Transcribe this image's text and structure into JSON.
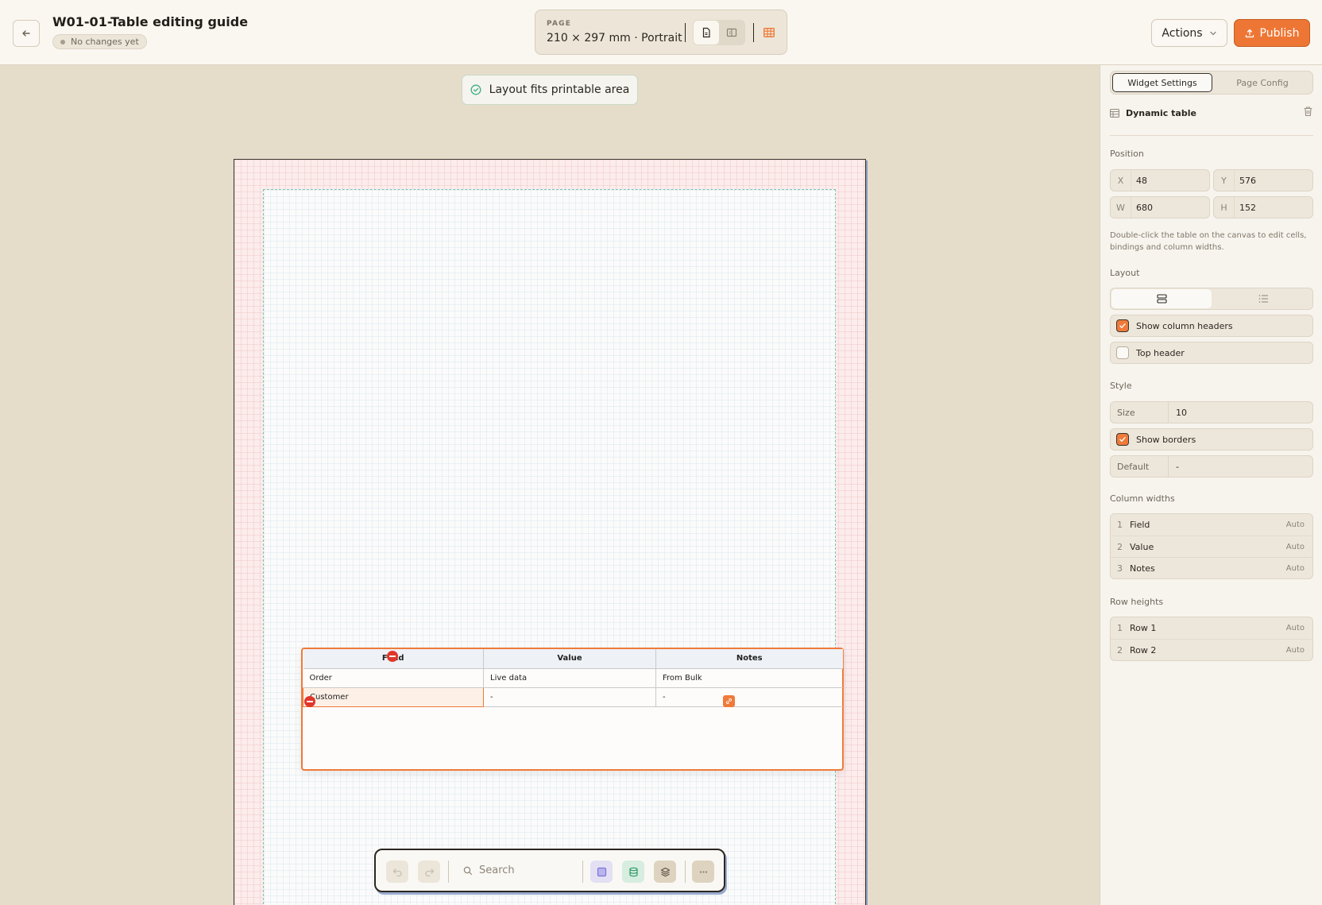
{
  "header": {
    "title": "W01-01-Table editing guide",
    "status": "No changes yet",
    "page_caption": "PAGE",
    "page_size": "210 × 297 mm · Portrait",
    "actions_label": "Actions",
    "publish_label": "Publish"
  },
  "canvas": {
    "fit_message": "Layout fits printable area"
  },
  "table": {
    "headers": [
      "Field",
      "Value",
      "Notes"
    ],
    "rows": [
      [
        "Order",
        "Live data",
        "From Bulk"
      ],
      [
        "Customer",
        "-",
        "-"
      ]
    ]
  },
  "toolbar": {
    "search_placeholder": "Search"
  },
  "panel": {
    "tabs": [
      "Widget Settings",
      "Page Config"
    ],
    "widget_name": "Dynamic table",
    "position_title": "Position",
    "position": {
      "x_label": "X",
      "x": "48",
      "y_label": "Y",
      "y": "576",
      "w_label": "W",
      "w": "680",
      "h_label": "H",
      "h": "152"
    },
    "hint": "Double-click the table on the canvas to edit cells, bindings and column widths.",
    "layout_title": "Layout",
    "show_column_headers": "Show column headers",
    "top_header": "Top header",
    "style_title": "Style",
    "size_label": "Size",
    "size_value": "10",
    "show_borders": "Show borders",
    "default_label": "Default",
    "default_value": "-",
    "column_widths_title": "Column widths",
    "column_widths": [
      {
        "num": "1",
        "name": "Field",
        "value": "Auto"
      },
      {
        "num": "2",
        "name": "Value",
        "value": "Auto"
      },
      {
        "num": "3",
        "name": "Notes",
        "value": "Auto"
      }
    ],
    "row_heights_title": "Row heights",
    "row_heights": [
      {
        "num": "1",
        "name": "Row 1",
        "value": "Auto"
      },
      {
        "num": "2",
        "name": "Row 2",
        "value": "Auto"
      }
    ]
  },
  "colors": {
    "accent": "#ee7634",
    "canvas_bg": "#e5ddca",
    "remove_red": "#e0362c"
  }
}
